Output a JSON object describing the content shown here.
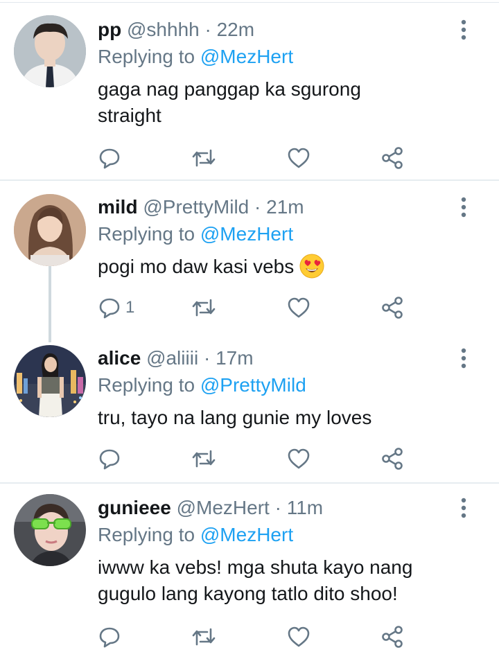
{
  "tweets": [
    {
      "name": "pp",
      "handle": "@shhhh",
      "separator": "·",
      "time": "22m",
      "replying_prefix": "Replying to",
      "replying_to": "@MezHert",
      "text_lines": [
        "gaga nag panggap ka sgurong",
        "straight"
      ],
      "reply_count": "",
      "avatar_icon": "avatar-photo-man-school-uniform"
    },
    {
      "name": "mild",
      "handle": "@PrettyMild",
      "separator": "·",
      "time": "21m",
      "replying_prefix": "Replying to",
      "replying_to": "@MezHert",
      "text_lines": [
        "pogi mo daw kasi vebs"
      ],
      "emoji": "heart-eyes-emoji",
      "reply_count": "1",
      "avatar_icon": "avatar-photo-woman-long-hair"
    },
    {
      "name": "alice",
      "handle": "@aliiii",
      "separator": "·",
      "time": "17m",
      "replying_prefix": "Replying to",
      "replying_to": "@PrettyMild",
      "text_lines": [
        "tru, tayo na lang gunie my loves"
      ],
      "reply_count": "",
      "avatar_icon": "avatar-photo-woman-city-night"
    },
    {
      "name": "gunieee",
      "handle": "@MezHert",
      "separator": "·",
      "time": "11m",
      "replying_prefix": "Replying to",
      "replying_to": "@MezHert",
      "text_lines": [
        "iwww ka vebs! mga shuta kayo nang",
        "gugulo lang kayong tatlo dito shoo!"
      ],
      "reply_count": "",
      "avatar_icon": "avatar-photo-man-green-sunglasses"
    }
  ],
  "action_icons": [
    "reply-icon",
    "retweet-icon",
    "like-icon",
    "share-icon"
  ],
  "colors": {
    "text": "#14171a",
    "muted": "#657786",
    "link": "#1da1f2",
    "divider": "#e6ecf0",
    "icon": "#657786"
  }
}
